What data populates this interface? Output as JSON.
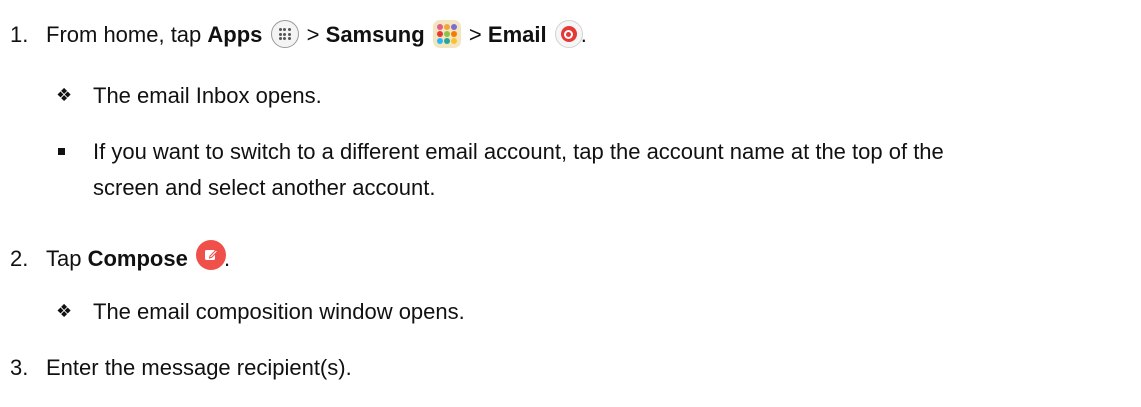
{
  "steps": [
    {
      "number": "1.",
      "prefix": "From home, tap",
      "apps_label": "Apps",
      "sep1": ">",
      "samsung_label": "Samsung",
      "sep2": ">",
      "email_label": "Email",
      "suffix": "."
    },
    {
      "number": "2.",
      "prefix": "Tap",
      "compose_label": "Compose",
      "suffix": "."
    },
    {
      "number": "3.",
      "text": "Enter the message recipient(s)."
    }
  ],
  "notes": {
    "inbox_opens": "The email Inbox opens.",
    "switch_account_line1": "If you want to switch to a different email account, tap the account name at the top of the",
    "switch_account_line2": "screen and select another account.",
    "composition_opens": "The email composition window opens."
  },
  "icons": {
    "apps": "apps-grid-icon",
    "samsung": "samsung-folder-icon",
    "email": "email-app-icon",
    "compose": "compose-icon",
    "diamond_bullet": "diamond-bullet-icon",
    "square_bullet": "square-bullet-icon"
  },
  "colors": {
    "text": "#111111",
    "email_red": "#e53935",
    "compose_red": "#f0504a",
    "samsung_folder": "#f3e5bf"
  }
}
